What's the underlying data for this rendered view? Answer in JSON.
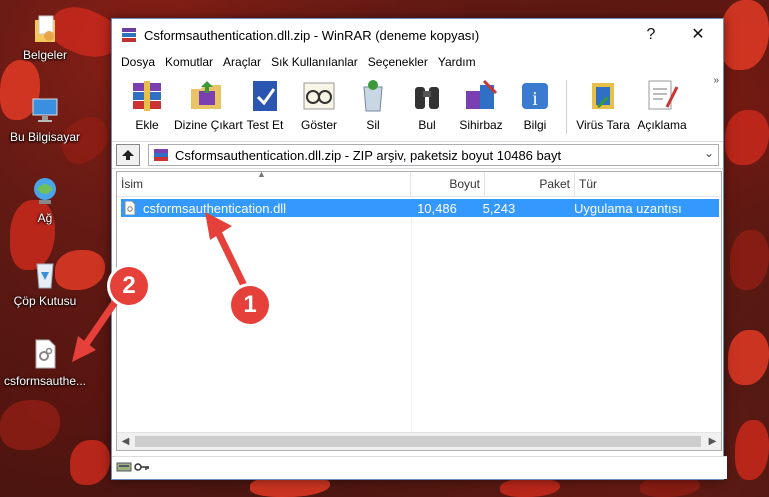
{
  "desktop": {
    "icons": [
      {
        "label": "Belgeler"
      },
      {
        "label": "Bu Bilgisayar"
      },
      {
        "label": "Ağ"
      },
      {
        "label": "Çöp Kutusu"
      },
      {
        "label": "csformsauthe..."
      }
    ],
    "markers": [
      "1",
      "2"
    ]
  },
  "window": {
    "title": "Csformsauthentication.dll.zip - WinRAR (deneme kopyası)",
    "help_btn": "?",
    "close_btn": "✕",
    "menu": [
      "Dosya",
      "Komutlar",
      "Araçlar",
      "Sık Kullanılanlar",
      "Seçenekler",
      "Yardım"
    ],
    "toolbar": [
      "Ekle",
      "Dizine Çıkart",
      "Test Et",
      "Göster",
      "Sil",
      "Bul",
      "Sihirbaz",
      "Bilgi",
      "Virüs Tara",
      "Açıklama"
    ],
    "toolbar_more": "»",
    "address": "Csformsauthentication.dll.zip - ZIP arşiv, paketsiz boyut 10486 bayt",
    "columns": [
      "İsim",
      "Boyut",
      "Paket",
      "Tür"
    ],
    "files": [
      {
        "name": "csformsauthentication.dll",
        "size": "10,486",
        "packed": "5,243",
        "type": "Uygulama uzantısı"
      }
    ]
  },
  "colors": {
    "selection": "#3399ff",
    "marker": "#e5413a",
    "leaf": "#c9291c"
  }
}
